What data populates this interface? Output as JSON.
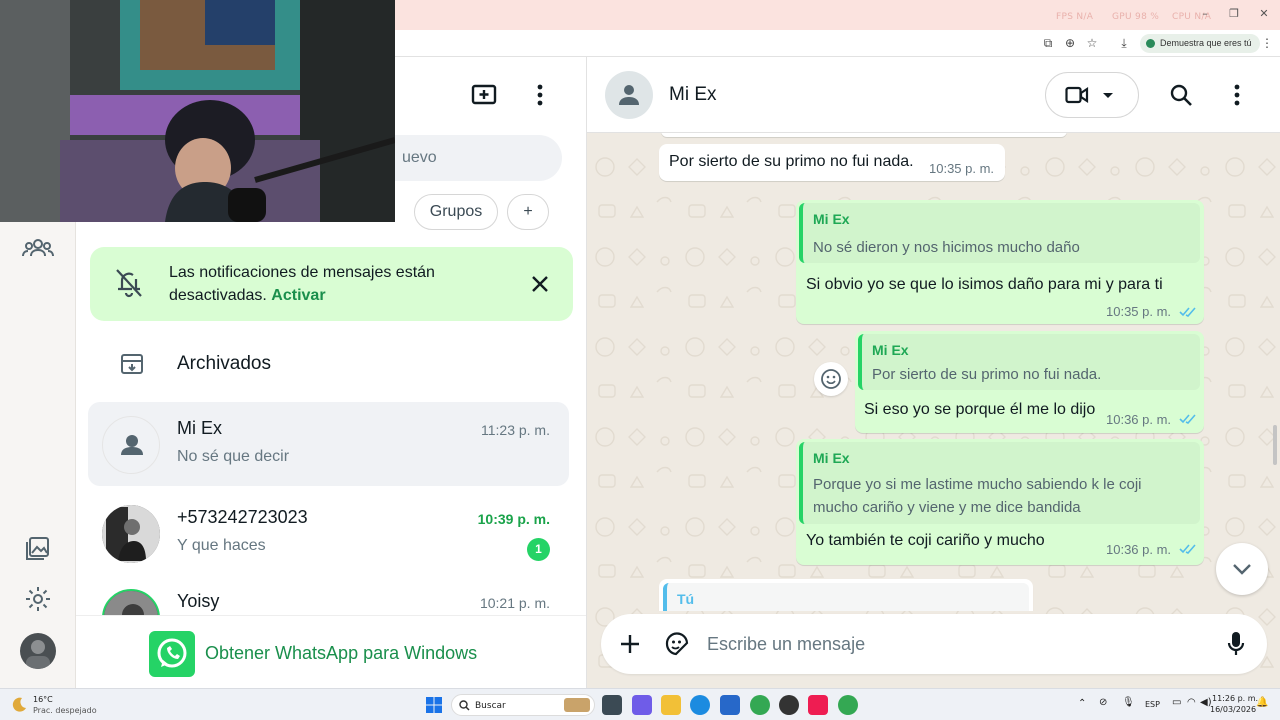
{
  "browser": {
    "hud_fps": "FPS N/A",
    "hud_gpu": "GPU 98 %",
    "hud_cpu": "CPU N/A",
    "verify_label": "Demuestra que eres tú"
  },
  "sidebar_list": {
    "search_placeholder_visible": "uevo",
    "filters": [
      "Grupos",
      "+"
    ],
    "notification": {
      "text": "Las notificaciones de mensajes están desactivadas.",
      "link": "Activar"
    },
    "archived_label": "Archivados",
    "chats": [
      {
        "name": "Mi Ex",
        "preview": "No sé que decir",
        "time": "11:23 p. m.",
        "unread": ""
      },
      {
        "name": "+573242723023",
        "preview": "Y que haces",
        "time": "10:39 p. m.",
        "unread": "1"
      },
      {
        "name": "Yoisy",
        "preview": "",
        "time": "10:21 p. m.",
        "unread": ""
      }
    ],
    "get_app_label": "Obtener WhatsApp para Windows"
  },
  "conversation": {
    "contact_name": "Mi Ex",
    "messages": [
      {
        "dir": "in",
        "text": "Por sierto de su primo no fui nada.",
        "time": "10:35 p. m."
      },
      {
        "dir": "out",
        "quote_author": "Mi Ex",
        "quote_lines": [
          "No sé dieron y nos hicimos mucho daño"
        ],
        "text": "Si obvio yo se que lo isimos daño para mi y para ti",
        "time": "10:35 p. m."
      },
      {
        "dir": "out",
        "quote_author": "Mi Ex",
        "quote_lines": [
          "Por sierto de su primo no fui nada."
        ],
        "text": "Si eso yo se porque él me lo dijo",
        "time": "10:36 p. m."
      },
      {
        "dir": "out",
        "quote_author": "Mi Ex",
        "quote_lines": [
          "Porque yo si me lastime mucho sabiendo k le coji",
          "mucho cariño y viene y me dice bandida"
        ],
        "text": "Yo también te coji cariño y mucho",
        "time": "10:36 p. m."
      },
      {
        "dir": "in",
        "quote_author": "Tú"
      }
    ],
    "composer_placeholder": "Escribe un mensaje"
  },
  "taskbar": {
    "weather_temp": "16°C",
    "weather_desc": "Prac. despejado",
    "search_label": "Buscar",
    "lang": "ESP",
    "time": "11:26 p. m.",
    "date": "16/03/2026"
  },
  "colors": {
    "accent_green": "#25d366",
    "outgoing_bubble": "#d9fdd3",
    "read_ticks": "#53bdeb",
    "notif_bg": "#d9fdd3"
  }
}
